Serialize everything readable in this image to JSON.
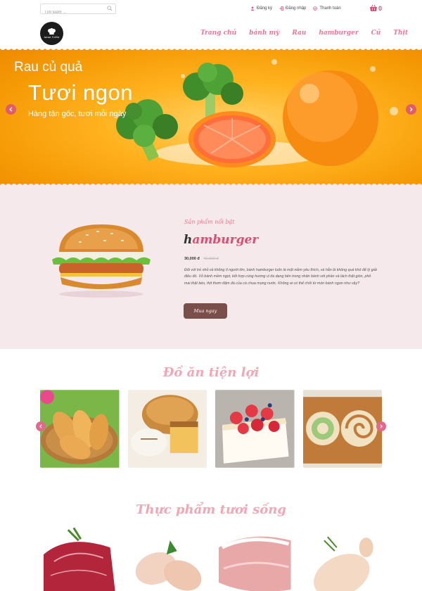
{
  "header": {
    "search": {
      "placeholder": "Tìm kiếm ..."
    },
    "links": [
      {
        "label": "Đăng ký",
        "icon": "user-icon"
      },
      {
        "label": "Đăng nhập",
        "icon": "login-icon"
      },
      {
        "label": "Thanh toán",
        "icon": "checkout-icon"
      }
    ],
    "cart_count": "0",
    "logo_text": "Anna Cotta"
  },
  "nav": {
    "items": [
      "Trang chủ",
      "bánh mỳ",
      "Rau",
      "hamburger",
      "Củ",
      "Thịt"
    ]
  },
  "hero": {
    "line1": "Rau củ quả",
    "line2": "Tươi ngon",
    "line3": "Hàng tận gốc, tươi mỗi ngày"
  },
  "featured": {
    "tag": "Sản phẩm nổi bật",
    "title_first": "h",
    "title_rest": "amburger",
    "price": "30,000 đ",
    "old_price": "40,000 đ",
    "description": "Đối với trẻ nhỏ và không ít người lớn, bánh hamburger luôn là một niềm yêu thích, và hẳn là không quá khó để lý giải điều đó. Vỏ bánh mềm ngọt, kết hợp cùng hương vị đa dạng bên trong nhân bánh với phần xà lách thật giòn, phô mai thật béo, thịt thơm đậm đà của cà chua mọng nước. Không ai có thể chối từ món bánh ngon như vậy?",
    "buy_label": "Mua ngay"
  },
  "sections": {
    "convenience_title": "Đồ ăn tiện lợi",
    "fresh_title": "Thực phẩm tươi sống"
  },
  "colors": {
    "accent": "#e67a96",
    "brand_pink": "#d84f76",
    "hero_orange": "#f59a05",
    "featured_bg": "#f6e9ec",
    "button_brown": "#7a4e4a"
  }
}
